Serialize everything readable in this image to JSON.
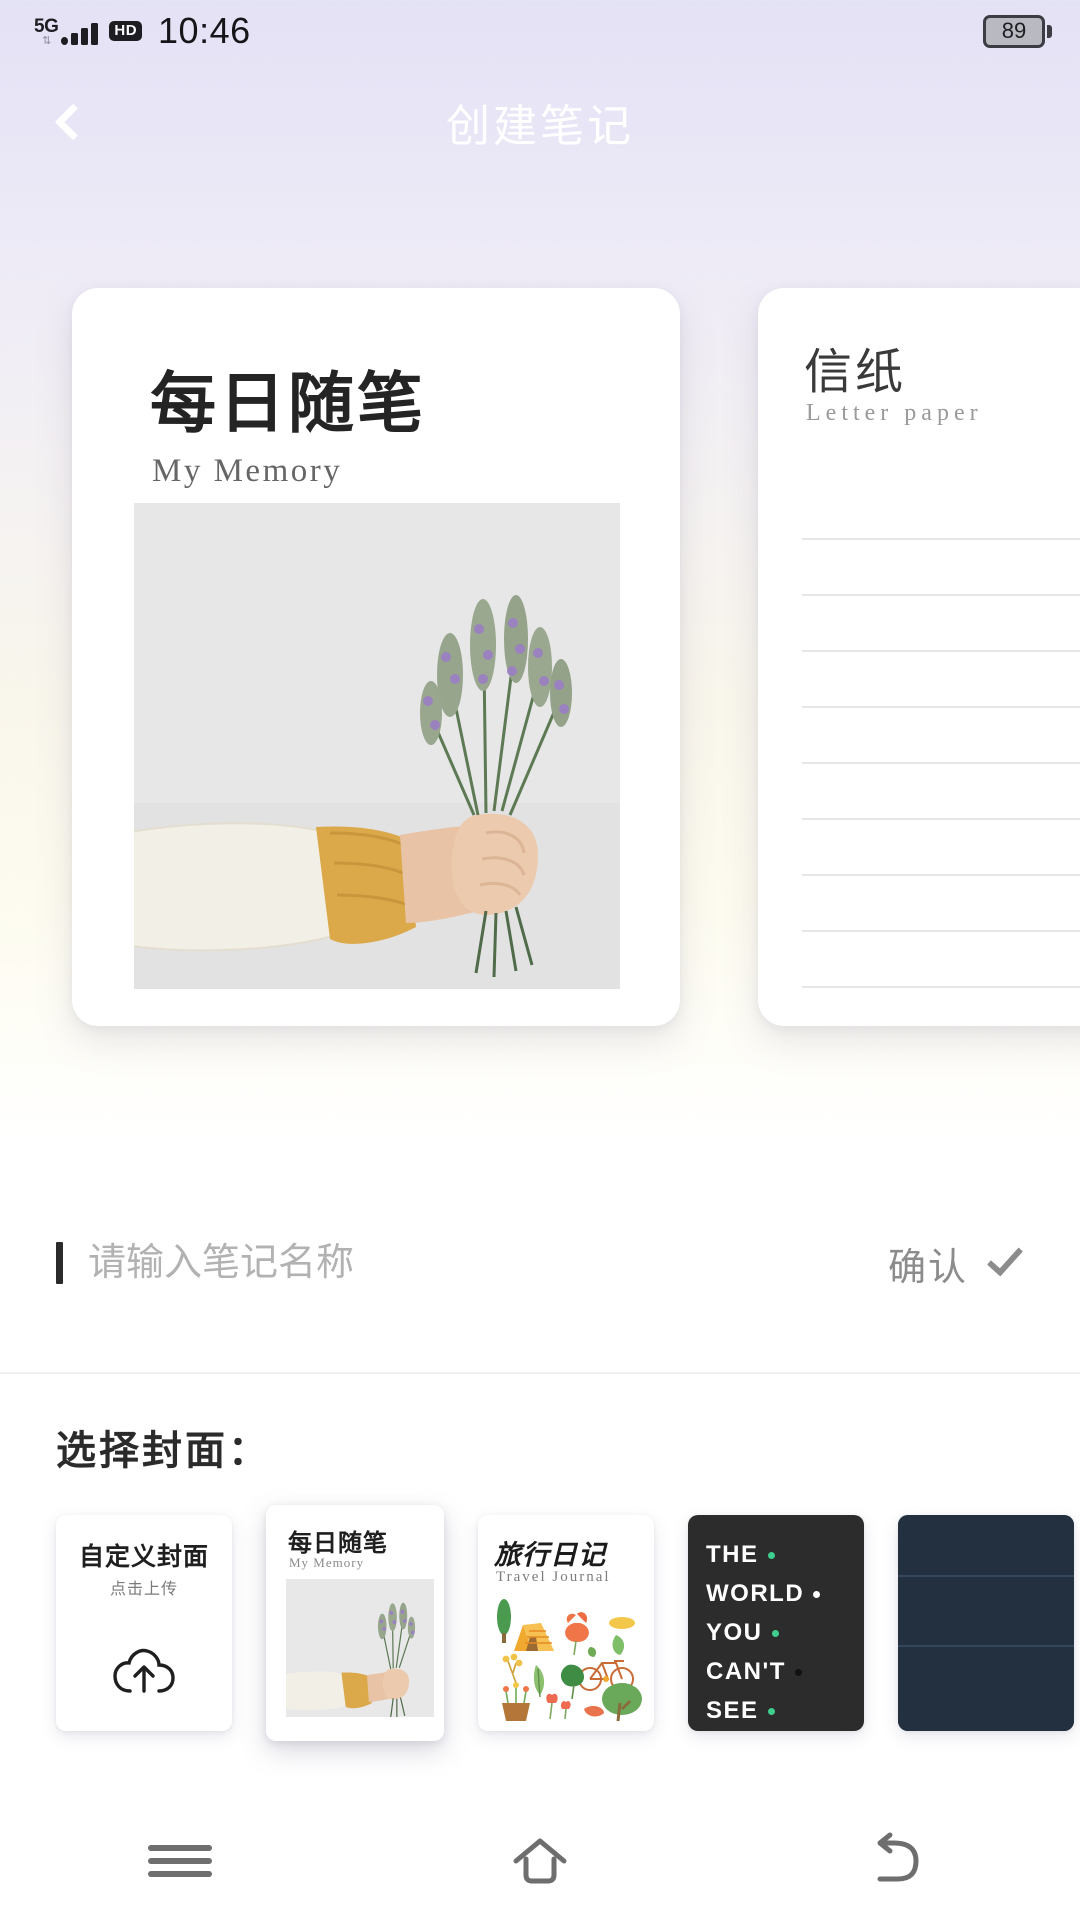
{
  "status_bar": {
    "network": "5G",
    "network_arrows": "⇅",
    "voice_badge": "HD",
    "time": "10:46",
    "battery_level": "89"
  },
  "app_bar": {
    "back_icon": "chevron-left-icon",
    "title": "创建笔记"
  },
  "carousel": {
    "covers": [
      {
        "id": "my-memory",
        "title": "每日随笔",
        "subtitle": "My Memory",
        "image_alt": "hand-holding-lavender-photo"
      },
      {
        "id": "letter-paper",
        "title": "信纸",
        "subtitle": "Letter paper",
        "line_count": 10
      }
    ]
  },
  "name_form": {
    "input_value": "",
    "placeholder": "请输入笔记名称",
    "confirm_label": "确认",
    "confirm_icon": "check-icon"
  },
  "cover_picker": {
    "section_label": "选择封面：",
    "items": [
      {
        "id": "custom",
        "title": "自定义封面",
        "subtitle": "点击上传",
        "icon": "cloud-upload-icon",
        "selected": false
      },
      {
        "id": "my-memory",
        "title": "每日随笔",
        "subtitle": "My Memory",
        "selected": true
      },
      {
        "id": "travel-journal",
        "title": "旅行日记",
        "subtitle": "Travel Journal",
        "selected": false
      },
      {
        "id": "dark-world",
        "lines": [
          "THE",
          "WORLD",
          "YOU",
          "CAN'T",
          "SEE"
        ],
        "dot_colors": [
          "#3ecf8e",
          "#ffffff",
          "#3ecf8e",
          "#111111",
          "#3ecf8e"
        ],
        "selected": false
      },
      {
        "id": "navy-cover",
        "selected": false
      }
    ]
  },
  "nav_bar": {
    "recents_icon": "menu-icon",
    "home_icon": "home-icon",
    "back_icon": "back-arrow-icon"
  },
  "colors": {
    "background_top": "#e3e1f4",
    "background_bottom": "#fefdf6",
    "sheet": "#ffffff",
    "accent_green": "#3ecf8e",
    "dark_cover": "#2c2c2c",
    "muted_text": "#8c8c8c"
  }
}
